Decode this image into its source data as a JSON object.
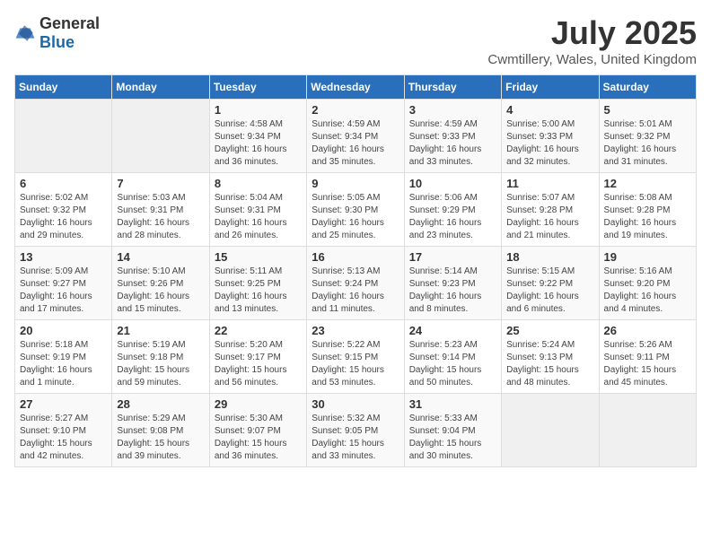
{
  "header": {
    "logo_general": "General",
    "logo_blue": "Blue",
    "month_title": "July 2025",
    "location": "Cwmtillery, Wales, United Kingdom"
  },
  "days_of_week": [
    "Sunday",
    "Monday",
    "Tuesday",
    "Wednesday",
    "Thursday",
    "Friday",
    "Saturday"
  ],
  "weeks": [
    [
      {
        "day": "",
        "content": ""
      },
      {
        "day": "",
        "content": ""
      },
      {
        "day": "1",
        "content": "Sunrise: 4:58 AM\nSunset: 9:34 PM\nDaylight: 16 hours and 36 minutes."
      },
      {
        "day": "2",
        "content": "Sunrise: 4:59 AM\nSunset: 9:34 PM\nDaylight: 16 hours and 35 minutes."
      },
      {
        "day": "3",
        "content": "Sunrise: 4:59 AM\nSunset: 9:33 PM\nDaylight: 16 hours and 33 minutes."
      },
      {
        "day": "4",
        "content": "Sunrise: 5:00 AM\nSunset: 9:33 PM\nDaylight: 16 hours and 32 minutes."
      },
      {
        "day": "5",
        "content": "Sunrise: 5:01 AM\nSunset: 9:32 PM\nDaylight: 16 hours and 31 minutes."
      }
    ],
    [
      {
        "day": "6",
        "content": "Sunrise: 5:02 AM\nSunset: 9:32 PM\nDaylight: 16 hours and 29 minutes."
      },
      {
        "day": "7",
        "content": "Sunrise: 5:03 AM\nSunset: 9:31 PM\nDaylight: 16 hours and 28 minutes."
      },
      {
        "day": "8",
        "content": "Sunrise: 5:04 AM\nSunset: 9:31 PM\nDaylight: 16 hours and 26 minutes."
      },
      {
        "day": "9",
        "content": "Sunrise: 5:05 AM\nSunset: 9:30 PM\nDaylight: 16 hours and 25 minutes."
      },
      {
        "day": "10",
        "content": "Sunrise: 5:06 AM\nSunset: 9:29 PM\nDaylight: 16 hours and 23 minutes."
      },
      {
        "day": "11",
        "content": "Sunrise: 5:07 AM\nSunset: 9:28 PM\nDaylight: 16 hours and 21 minutes."
      },
      {
        "day": "12",
        "content": "Sunrise: 5:08 AM\nSunset: 9:28 PM\nDaylight: 16 hours and 19 minutes."
      }
    ],
    [
      {
        "day": "13",
        "content": "Sunrise: 5:09 AM\nSunset: 9:27 PM\nDaylight: 16 hours and 17 minutes."
      },
      {
        "day": "14",
        "content": "Sunrise: 5:10 AM\nSunset: 9:26 PM\nDaylight: 16 hours and 15 minutes."
      },
      {
        "day": "15",
        "content": "Sunrise: 5:11 AM\nSunset: 9:25 PM\nDaylight: 16 hours and 13 minutes."
      },
      {
        "day": "16",
        "content": "Sunrise: 5:13 AM\nSunset: 9:24 PM\nDaylight: 16 hours and 11 minutes."
      },
      {
        "day": "17",
        "content": "Sunrise: 5:14 AM\nSunset: 9:23 PM\nDaylight: 16 hours and 8 minutes."
      },
      {
        "day": "18",
        "content": "Sunrise: 5:15 AM\nSunset: 9:22 PM\nDaylight: 16 hours and 6 minutes."
      },
      {
        "day": "19",
        "content": "Sunrise: 5:16 AM\nSunset: 9:20 PM\nDaylight: 16 hours and 4 minutes."
      }
    ],
    [
      {
        "day": "20",
        "content": "Sunrise: 5:18 AM\nSunset: 9:19 PM\nDaylight: 16 hours and 1 minute."
      },
      {
        "day": "21",
        "content": "Sunrise: 5:19 AM\nSunset: 9:18 PM\nDaylight: 15 hours and 59 minutes."
      },
      {
        "day": "22",
        "content": "Sunrise: 5:20 AM\nSunset: 9:17 PM\nDaylight: 15 hours and 56 minutes."
      },
      {
        "day": "23",
        "content": "Sunrise: 5:22 AM\nSunset: 9:15 PM\nDaylight: 15 hours and 53 minutes."
      },
      {
        "day": "24",
        "content": "Sunrise: 5:23 AM\nSunset: 9:14 PM\nDaylight: 15 hours and 50 minutes."
      },
      {
        "day": "25",
        "content": "Sunrise: 5:24 AM\nSunset: 9:13 PM\nDaylight: 15 hours and 48 minutes."
      },
      {
        "day": "26",
        "content": "Sunrise: 5:26 AM\nSunset: 9:11 PM\nDaylight: 15 hours and 45 minutes."
      }
    ],
    [
      {
        "day": "27",
        "content": "Sunrise: 5:27 AM\nSunset: 9:10 PM\nDaylight: 15 hours and 42 minutes."
      },
      {
        "day": "28",
        "content": "Sunrise: 5:29 AM\nSunset: 9:08 PM\nDaylight: 15 hours and 39 minutes."
      },
      {
        "day": "29",
        "content": "Sunrise: 5:30 AM\nSunset: 9:07 PM\nDaylight: 15 hours and 36 minutes."
      },
      {
        "day": "30",
        "content": "Sunrise: 5:32 AM\nSunset: 9:05 PM\nDaylight: 15 hours and 33 minutes."
      },
      {
        "day": "31",
        "content": "Sunrise: 5:33 AM\nSunset: 9:04 PM\nDaylight: 15 hours and 30 minutes."
      },
      {
        "day": "",
        "content": ""
      },
      {
        "day": "",
        "content": ""
      }
    ]
  ]
}
